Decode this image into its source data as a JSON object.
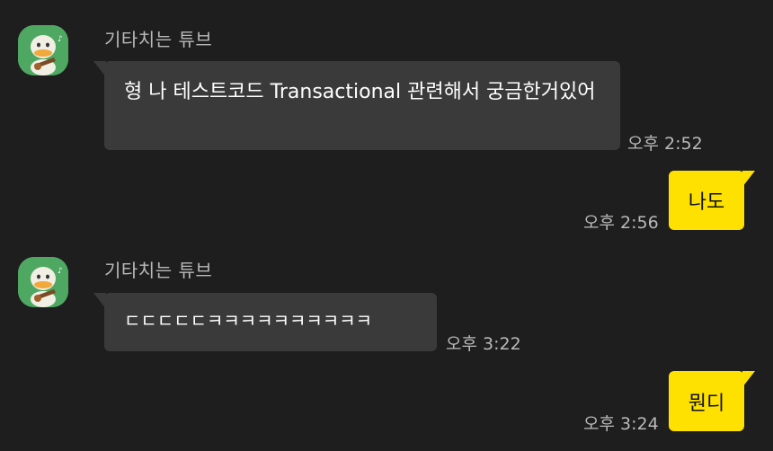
{
  "colors": {
    "background": "#1e1e1e",
    "incoming_bubble": "#3a3a3a",
    "outgoing_bubble": "#ffe100",
    "avatar_bg": "#4ea862",
    "meta_text": "#b9b9b9"
  },
  "messages": [
    {
      "sender": "기타치는 튜브",
      "avatar_icon": "duck-guitar-avatar-icon",
      "text": "형 나 테스트코드 Transactional 관련해서 궁금한거있어",
      "time": "오후 2:52"
    },
    {
      "text": "나도",
      "time": "오후 2:56"
    },
    {
      "sender": "기타치는 튜브",
      "avatar_icon": "duck-guitar-avatar-icon",
      "text": "ㄷㄷㄷㄷㄷㅋㅋㅋㅋㅋㅋㅋㅋㅋㅋ",
      "time": "오후 3:22"
    },
    {
      "text": "뭔디",
      "time": "오후 3:24"
    }
  ]
}
